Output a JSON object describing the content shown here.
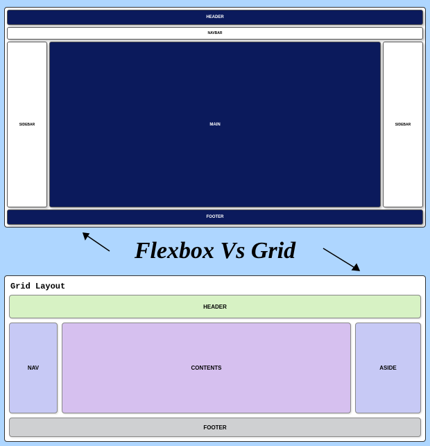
{
  "title": "Flexbox Vs Grid",
  "flex": {
    "header": "HEADER",
    "navbar": "NAVBAR",
    "sidebarL": "SIDEBAR",
    "main": "MAIN",
    "sidebarR": "SIDEBAR",
    "footer": "FOOTER"
  },
  "grid": {
    "title": "Grid Layout",
    "header": "HEADER",
    "nav": "NAV",
    "contents": "CONTENTS",
    "aside": "ASIDE",
    "footer": "FOOTER"
  }
}
